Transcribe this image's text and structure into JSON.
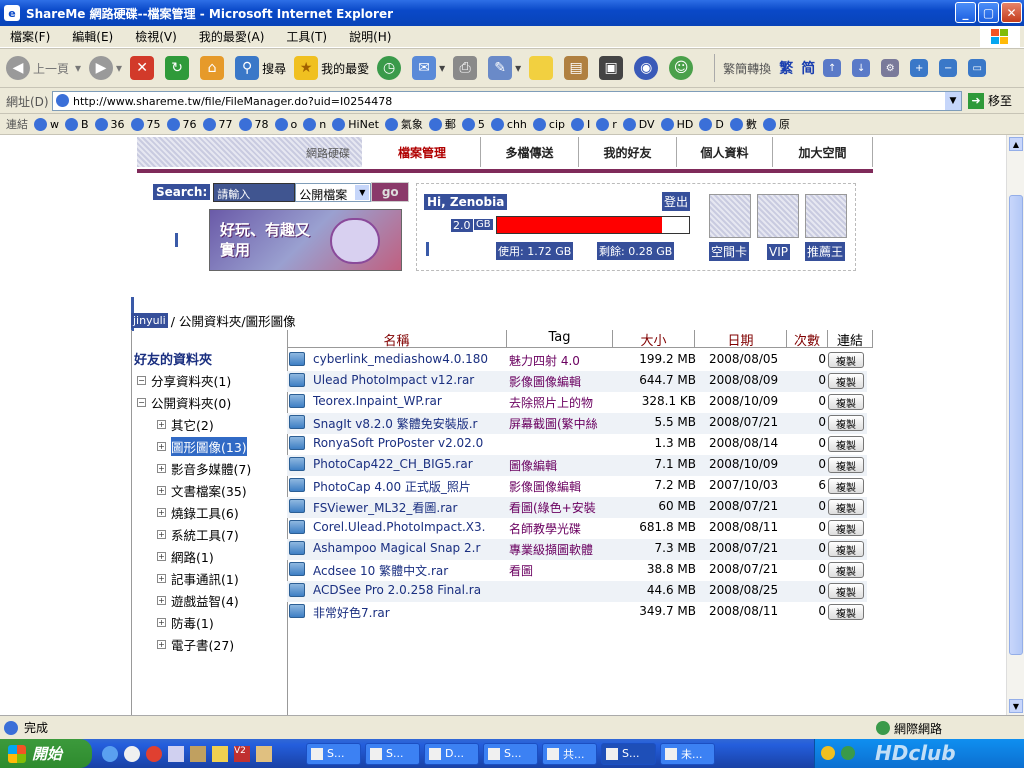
{
  "window": {
    "title": "ShareMe 網路硬碟--檔案管理 - Microsoft Internet Explorer"
  },
  "menu": [
    "檔案(F)",
    "編輯(E)",
    "檢視(V)",
    "我的最愛(A)",
    "工具(T)",
    "說明(H)"
  ],
  "toolbar": {
    "back": "上一頁",
    "search": "搜尋",
    "favorites": "我的最愛",
    "trad_simp": "繁簡轉換",
    "trad": "繁",
    "simp": "简"
  },
  "address": {
    "label": "網址(D)",
    "url": "http://www.shareme.tw/file/FileManager.do?uid=I0254478",
    "go": "移至"
  },
  "links": {
    "label": "連結",
    "items": [
      "w",
      "B",
      "36",
      "75",
      "76",
      "77",
      "78",
      "o",
      "n",
      "HiNet",
      "氣象",
      "郵",
      "5",
      "chh",
      "cip",
      "I",
      "r",
      "DV",
      "HD",
      "D",
      "數",
      "原"
    ]
  },
  "site": {
    "tabs": [
      "網路硬碟",
      "檔案管理",
      "多檔傳送",
      "我的好友",
      "個人資料",
      "加大空間"
    ],
    "search_label": "Search:",
    "search_value": "請輸入",
    "search_scope": "公開檔案",
    "search_go": "go",
    "banner_text": "好玩、有趣又實用",
    "greeting": "Hi, Zenobia",
    "logout": "登出",
    "quota": "2.0",
    "quota_unit": "GB",
    "usage_fraction": 0.86,
    "used": "使用: 1.72 GB",
    "remaining": "剩餘: 0.28 GB",
    "promo": [
      "空間卡",
      "VIP",
      "推薦王"
    ],
    "breadcrumb_user": "jinyuli",
    "breadcrumb_path": "/ 公開資料夾/圖形圖像",
    "tree_title": "好友的資料夾",
    "tree": [
      {
        "label": "分享資料夾(1)",
        "sign": "−",
        "level": 1
      },
      {
        "label": "公開資料夾(0)",
        "sign": "−",
        "level": 1
      },
      {
        "label": "其它(2)",
        "sign": "+",
        "level": 2
      },
      {
        "label": "圖形圖像(13)",
        "sign": "+",
        "level": 2,
        "selected": true
      },
      {
        "label": "影音多媒體(7)",
        "sign": "+",
        "level": 2
      },
      {
        "label": "文書檔案(35)",
        "sign": "+",
        "level": 2
      },
      {
        "label": "燒錄工具(6)",
        "sign": "+",
        "level": 2
      },
      {
        "label": "系統工具(7)",
        "sign": "+",
        "level": 2
      },
      {
        "label": "網路(1)",
        "sign": "+",
        "level": 2
      },
      {
        "label": "記事通訊(1)",
        "sign": "+",
        "level": 2
      },
      {
        "label": "遊戲益智(4)",
        "sign": "+",
        "level": 2
      },
      {
        "label": "防毒(1)",
        "sign": "+",
        "level": 2
      },
      {
        "label": "電子書(27)",
        "sign": "+",
        "level": 2
      }
    ],
    "headers": [
      "名稱",
      "Tag",
      "大小",
      "日期",
      "次數",
      "連結"
    ],
    "copy_label": "複製",
    "files": [
      {
        "name": "cyberlink_mediashow4.0.180",
        "tag": "魅力四射 4.0",
        "size": "199.2 MB",
        "date": "2008/08/05",
        "count": "0"
      },
      {
        "name": "Ulead PhotoImpact v12.rar",
        "tag": "影像圖像編輯",
        "size": "644.7 MB",
        "date": "2008/08/09",
        "count": "0"
      },
      {
        "name": "Teorex.Inpaint_WP.rar",
        "tag": "去除照片上的物",
        "size": "328.1 KB",
        "date": "2008/10/09",
        "count": "0"
      },
      {
        "name": "SnagIt v8.2.0 繁體免安裝版.r",
        "tag": "屏幕截圖(繁中絲",
        "size": "5.5 MB",
        "date": "2008/07/21",
        "count": "0"
      },
      {
        "name": "RonyaSoft ProPoster v2.02.0",
        "tag": "",
        "size": "1.3 MB",
        "date": "2008/08/14",
        "count": "0"
      },
      {
        "name": "PhotoCap422_CH_BIG5.rar",
        "tag": "圖像編輯",
        "size": "7.1 MB",
        "date": "2008/10/09",
        "count": "0"
      },
      {
        "name": "PhotoCap 4.00 正式版_照片",
        "tag": "影像圖像編輯",
        "size": "7.2 MB",
        "date": "2007/10/03",
        "count": "6"
      },
      {
        "name": "FSViewer_ML32_看圖.rar",
        "tag": "看圖(綠色+安裝",
        "size": "60 MB",
        "date": "2008/07/21",
        "count": "0"
      },
      {
        "name": "Corel.Ulead.PhotoImpact.X3.",
        "tag": "名師教學光碟",
        "size": "681.8 MB",
        "date": "2008/08/11",
        "count": "0"
      },
      {
        "name": "Ashampoo Magical Snap 2.r",
        "tag": "專業級擷圖軟體",
        "size": "7.3 MB",
        "date": "2008/07/21",
        "count": "0"
      },
      {
        "name": "Acdsee 10 繁體中文.rar",
        "tag": "看圖",
        "size": "38.8 MB",
        "date": "2008/07/21",
        "count": "0"
      },
      {
        "name": "ACDSee Pro 2.0.258 Final.ra",
        "tag": "",
        "size": "44.6 MB",
        "date": "2008/08/25",
        "count": "0"
      },
      {
        "name": "非常好色7.rar",
        "tag": "",
        "size": "349.7 MB",
        "date": "2008/08/11",
        "count": "0"
      }
    ]
  },
  "status": {
    "text": "完成",
    "zone": "網際網路"
  },
  "taskbar": {
    "start": "開始",
    "tasks": [
      "S...",
      "S...",
      "D...",
      "S...",
      "共...",
      "S...",
      "未..."
    ]
  },
  "watermark": "HDclub"
}
